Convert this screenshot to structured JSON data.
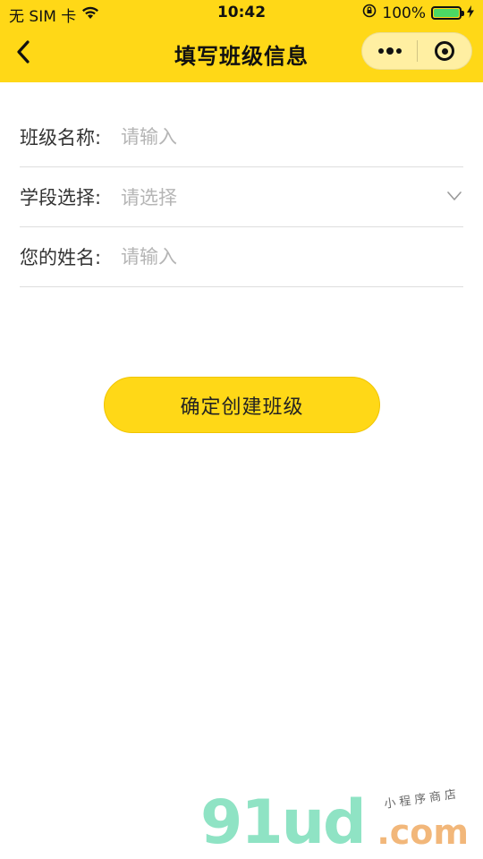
{
  "status_bar": {
    "carrier": "无 SIM 卡",
    "time": "10:42",
    "battery_pct": "100%",
    "battery_color": "#4cd964"
  },
  "nav": {
    "title": "填写班级信息",
    "back_icon": "chevron-left-icon",
    "more_icon": "more-dots-icon",
    "close_icon": "target-circle-icon",
    "bg_color": "#ffd817"
  },
  "form": {
    "class_name": {
      "label": "班级名称:",
      "placeholder": "请输入"
    },
    "stage": {
      "label": "学段选择:",
      "placeholder": "请选择",
      "icon": "chevron-down-icon"
    },
    "your_name": {
      "label": "您的姓名:",
      "placeholder": "请输入"
    }
  },
  "submit": {
    "label": "确定创建班级"
  },
  "watermark": {
    "main": "91ud",
    "domain": ".com",
    "tagline": "小程序商店"
  }
}
